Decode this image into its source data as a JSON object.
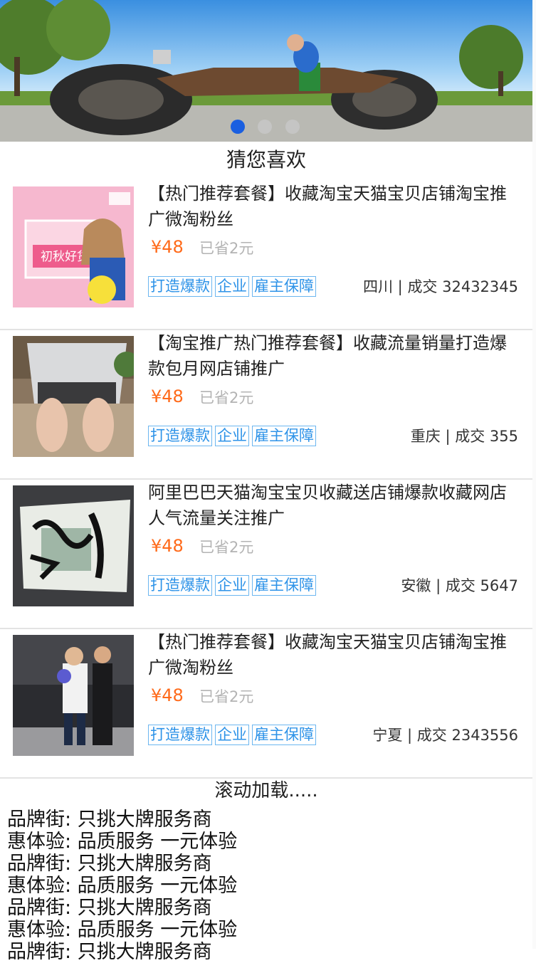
{
  "banner": {
    "image_alt": "giant motorcycle banner",
    "active_index": 0,
    "slide_count": 3
  },
  "section_title": "猜您喜欢",
  "products": [
    {
      "title": "【热门推荐套餐】收藏淘宝天猫宝贝店铺淘宝推广微淘粉丝",
      "price": "¥48",
      "saved": "已省2元",
      "tags": [
        "打造爆款",
        "企业",
        "雇主保障"
      ],
      "region": "四川",
      "deals": "成交 32432345",
      "thumb_text": "初秋好货"
    },
    {
      "title": "【淘宝推广热门推荐套餐】收藏流量销量打造爆款包月网店铺推广",
      "price": "¥48",
      "saved": "已省2元",
      "tags": [
        "打造爆款",
        "企业",
        "雇主保障"
      ],
      "region": "重庆",
      "deals": "成交 355"
    },
    {
      "title": "阿里巴巴天猫淘宝宝贝收藏送店铺爆款收藏网店人气流量关注推广",
      "price": "¥48",
      "saved": "已省2元",
      "tags": [
        "打造爆款",
        "企业",
        "雇主保障"
      ],
      "region": "安徽",
      "deals": "成交 5647"
    },
    {
      "title": "【热门推荐套餐】收藏淘宝天猫宝贝店铺淘宝推广微淘粉丝",
      "price": "¥48",
      "saved": "已省2元",
      "tags": [
        "打造爆款",
        "企业",
        "雇主保障"
      ],
      "region": "宁夏",
      "deals": "成交 2343556"
    }
  ],
  "loading_text": "滚动加载.....",
  "promo_lines": [
    "品牌街: 只挑大牌服务商",
    "惠体验: 品质服务 一元体验",
    "品牌街: 只挑大牌服务商",
    "惠体验: 品质服务 一元体验",
    "品牌街: 只挑大牌服务商",
    "惠体验: 品质服务 一元体验",
    "品牌街: 只挑大牌服务商"
  ],
  "colors": {
    "accent_price": "#ff6a1a",
    "tag_blue": "#2e93e8",
    "dot_active": "#1a5fe0"
  }
}
